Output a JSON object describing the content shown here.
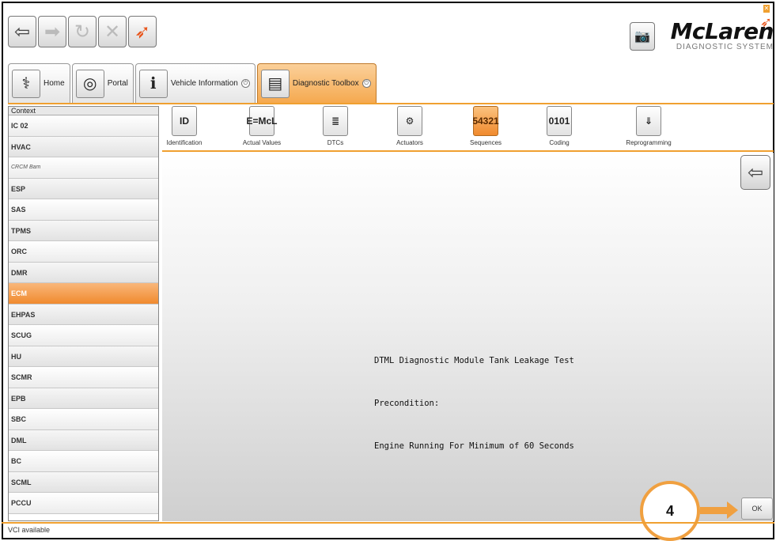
{
  "toolbar": {
    "buttons": [
      {
        "icon": "back-arrow-icon",
        "glyph": "⇦"
      },
      {
        "icon": "forward-arrow-icon",
        "glyph": "➡"
      },
      {
        "icon": "refresh-icon",
        "glyph": "↻"
      },
      {
        "icon": "close-icon",
        "glyph": "✕"
      },
      {
        "icon": "mclaren-swoosh-icon",
        "glyph": "➶"
      }
    ]
  },
  "brand": {
    "name": "McLaren",
    "subtitle": "DIAGNOSTIC SYSTEM",
    "accent": "#e8541a"
  },
  "tabs": [
    {
      "label": "Home",
      "icon": "stethoscope-icon",
      "glyph": "⚕",
      "power": false
    },
    {
      "label": "Portal",
      "icon": "portal-icon",
      "glyph": "◎",
      "power": false
    },
    {
      "label": "Vehicle Information",
      "icon": "info-icon",
      "glyph": "ℹ",
      "power": true
    },
    {
      "label": "Diagnostic Toolbox",
      "icon": "toolbox-icon",
      "glyph": "▤",
      "power": true,
      "active": true
    }
  ],
  "context": {
    "header": "Context",
    "items": [
      "IC 02",
      "HVAC",
      "CRCM Bam",
      "ESP",
      "SAS",
      "TPMS",
      "ORC",
      "DMR",
      "ECM",
      "EHPAS",
      "SCUG",
      "HU",
      "SCMR",
      "EPB",
      "SBC",
      "DML",
      "BC",
      "SCML",
      "PCCU"
    ],
    "selected": "ECM"
  },
  "functions": [
    {
      "label": "Identification",
      "icon": "identification-icon",
      "glyph": "ID"
    },
    {
      "label": "Actual Values",
      "icon": "actual-values-icon",
      "glyph": "E=McL"
    },
    {
      "label": "DTCs",
      "icon": "dtcs-icon",
      "glyph": "≣"
    },
    {
      "label": "Actuators",
      "icon": "actuators-icon",
      "glyph": "⚙"
    },
    {
      "label": "Sequences",
      "icon": "sequences-icon",
      "glyph": "54321",
      "active": true
    },
    {
      "label": "Coding",
      "icon": "coding-icon",
      "glyph": "0101"
    },
    {
      "label": "Reprogramming",
      "icon": "reprogramming-icon",
      "glyph": "⇓"
    }
  ],
  "main": {
    "message_lines": [
      "DTML Diagnostic Module Tank Leakage Test",
      "Precondition:",
      "Engine Running For Minimum of 60 Seconds"
    ],
    "ok_label": "OK"
  },
  "annotation": {
    "number": "4"
  },
  "status": {
    "text": "VCI available"
  },
  "colors": {
    "accent": "#f0a030",
    "active_tab": "#f5a94f"
  }
}
